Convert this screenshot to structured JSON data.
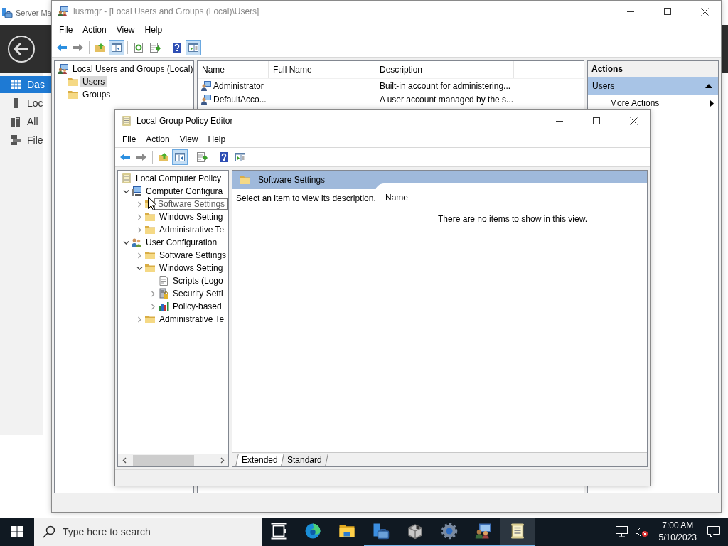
{
  "background_window": {
    "title": "Server Ma",
    "nav": [
      {
        "label": "Das",
        "kind": "dashboard",
        "selected": true
      },
      {
        "label": "Loc",
        "kind": "local",
        "selected": false
      },
      {
        "label": "All",
        "kind": "all",
        "selected": false
      },
      {
        "label": "File",
        "kind": "file",
        "selected": false
      }
    ]
  },
  "lusrmgr": {
    "title": "lusrmgr - [Local Users and Groups (Local)\\Users]",
    "active": false,
    "menu": [
      "File",
      "Action",
      "View",
      "Help"
    ],
    "toolbar": [
      {
        "kind": "back",
        "pressed": false
      },
      {
        "kind": "forward",
        "pressed": false
      },
      {
        "kind": "separator"
      },
      {
        "kind": "up",
        "pressed": false
      },
      {
        "kind": "tree",
        "pressed": true
      },
      {
        "kind": "separator"
      },
      {
        "kind": "refresh",
        "pressed": false
      },
      {
        "kind": "export",
        "pressed": false
      },
      {
        "kind": "separator"
      },
      {
        "kind": "help",
        "pressed": false
      },
      {
        "kind": "panel",
        "pressed": true
      }
    ],
    "tree": {
      "label": "Local Users and Groups (Local)",
      "kind": "users-computer",
      "selected": false,
      "children": [
        {
          "label": "Users",
          "kind": "folder",
          "selected": true
        },
        {
          "label": "Groups",
          "kind": "folder",
          "selected": false
        }
      ]
    },
    "columns": [
      "Name",
      "Full Name",
      "Description"
    ],
    "rows": [
      {
        "name": "Administrator",
        "description": "Built-in account for administering..."
      },
      {
        "name": "DefaultAcco...",
        "description": "A user account managed by the s..."
      }
    ],
    "actions": {
      "title": "Actions",
      "section": "Users",
      "expanded": true,
      "items": [
        "More Actions"
      ]
    }
  },
  "gpedit": {
    "title": "Local Group Policy Editor",
    "active": true,
    "menu": [
      "File",
      "Action",
      "View",
      "Help"
    ],
    "toolbar": [
      {
        "kind": "back",
        "pressed": false
      },
      {
        "kind": "forward",
        "pressed": false
      },
      {
        "kind": "separator"
      },
      {
        "kind": "up",
        "pressed": false
      },
      {
        "kind": "tree",
        "pressed": true
      },
      {
        "kind": "separator"
      },
      {
        "kind": "export",
        "pressed": false
      },
      {
        "kind": "separator"
      },
      {
        "kind": "help",
        "pressed": false
      },
      {
        "kind": "panel",
        "pressed": false
      }
    ],
    "tree": {
      "label": "Local Computer Policy",
      "kind": "policy",
      "children": [
        {
          "label": "Computer Configura",
          "kind": "computer",
          "expanded": true,
          "children": [
            {
              "label": "Software Settings",
              "kind": "folder",
              "expanded": false,
              "tooltip": true
            },
            {
              "label": "Windows Setting",
              "kind": "folder",
              "expanded": false
            },
            {
              "label": "Administrative Te",
              "kind": "folder",
              "expanded": false
            }
          ]
        },
        {
          "label": "User Configuration",
          "kind": "users",
          "expanded": true,
          "children": [
            {
              "label": "Software Settings",
              "kind": "folder",
              "expanded": false
            },
            {
              "label": "Windows Setting",
              "kind": "folder",
              "expanded": true,
              "children": [
                {
                  "label": "Scripts (Logo",
                  "kind": "script"
                },
                {
                  "label": "Security Setti",
                  "kind": "security",
                  "expanded": false
                },
                {
                  "label": "Policy-based",
                  "kind": "chart",
                  "expanded": false
                }
              ]
            },
            {
              "label": "Administrative Te",
              "kind": "folder",
              "expanded": false
            }
          ]
        }
      ]
    },
    "header": "Software Settings",
    "description": "Select an item to view its description.",
    "list_column": "Name",
    "empty_message": "There are no items to show in this view.",
    "tabs": [
      {
        "label": "Extended",
        "selected": true
      },
      {
        "label": "Standard",
        "selected": false
      }
    ]
  },
  "taskbar": {
    "search_placeholder": "Type here to search",
    "apps": [
      {
        "kind": "task-view",
        "running": false,
        "selected": false
      },
      {
        "kind": "edge",
        "running": false,
        "selected": false
      },
      {
        "kind": "explorer",
        "running": false,
        "selected": false
      },
      {
        "kind": "server-manager",
        "running": true,
        "selected": false
      },
      {
        "kind": "box",
        "running": true,
        "selected": false
      },
      {
        "kind": "gear",
        "running": true,
        "selected": false
      },
      {
        "kind": "users-computer",
        "running": true,
        "selected": false
      },
      {
        "kind": "policy",
        "running": true,
        "selected": true
      }
    ],
    "time": "7:00 AM",
    "date": "5/10/2023"
  }
}
